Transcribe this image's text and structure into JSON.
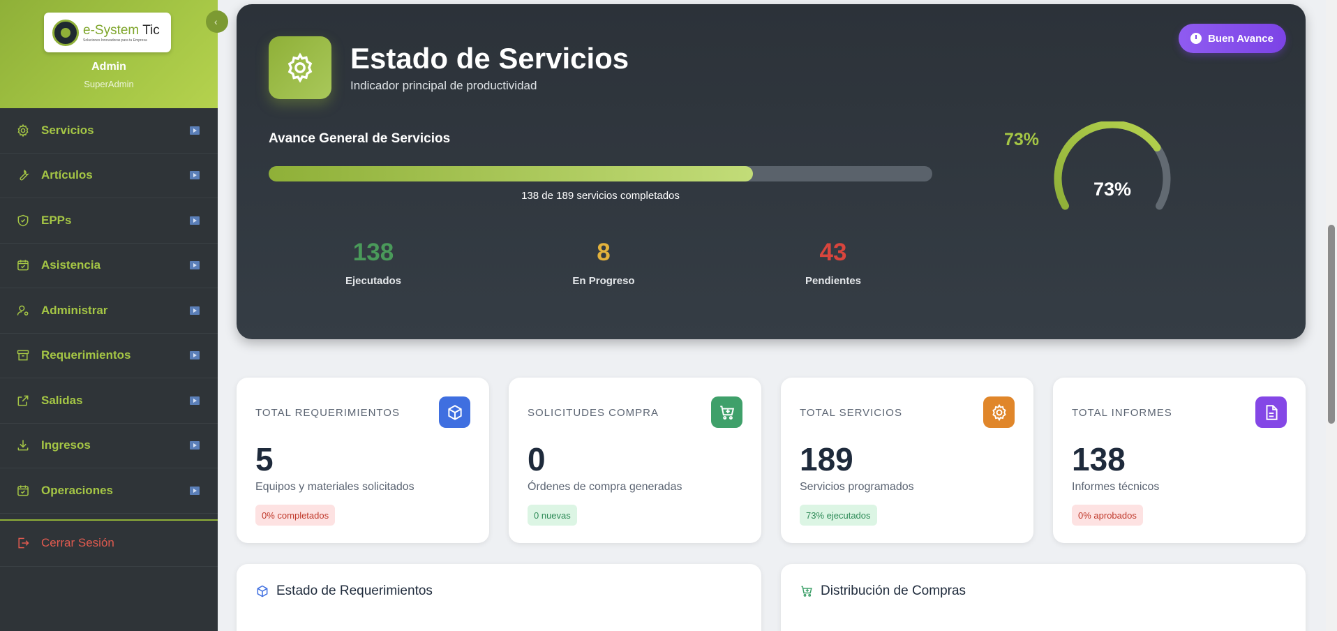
{
  "sidebar": {
    "logo": {
      "text_main": "e-System",
      "text_accent": "Tic",
      "tagline": "Soluciones Innovadoras para tu Empresa"
    },
    "user": {
      "name": "Admin",
      "role": "SuperAdmin"
    },
    "items": [
      {
        "label": "Servicios",
        "icon": "gear-icon"
      },
      {
        "label": "Artículos",
        "icon": "wrench-icon"
      },
      {
        "label": "EPPs",
        "icon": "shield-icon"
      },
      {
        "label": "Asistencia",
        "icon": "calendar-check-icon"
      },
      {
        "label": "Administrar",
        "icon": "user-gear-icon"
      },
      {
        "label": "Requerimientos",
        "icon": "archive-icon"
      },
      {
        "label": "Salidas",
        "icon": "external-link-icon"
      },
      {
        "label": "Ingresos",
        "icon": "download-icon"
      },
      {
        "label": "Operaciones",
        "icon": "calendar-check-icon"
      }
    ],
    "logout": {
      "label": "Cerrar Sesión",
      "icon": "logout-icon"
    }
  },
  "hero": {
    "title": "Estado de Servicios",
    "subtitle": "Indicador principal de productividad",
    "badge": "Buen Avance",
    "progress_label": "Avance General de Servicios",
    "progress_pct_text": "73%",
    "progress": 0.73,
    "caption": "138 de 189 servicios completados",
    "gauge_text": "73%",
    "stats": [
      {
        "value": "138",
        "label": "Ejecutados",
        "color": "#4a9a5a"
      },
      {
        "value": "8",
        "label": "En Progreso",
        "color": "#e3b23c"
      },
      {
        "value": "43",
        "label": "Pendientes",
        "color": "#d9453d"
      }
    ]
  },
  "cards": [
    {
      "title": "TOTAL REQUERIMIENTOS",
      "value": "5",
      "desc": "Equipos y materiales solicitados",
      "pill": "0% completados",
      "pill_style": "red",
      "icon": "box-icon",
      "icon_color": "#3f6fe0"
    },
    {
      "title": "SOLICITUDES COMPRA",
      "value": "0",
      "desc": "Órdenes de compra generadas",
      "pill": "0 nuevas",
      "pill_style": "green",
      "icon": "cart-plus-icon",
      "icon_color": "#3fa06a"
    },
    {
      "title": "TOTAL SERVICIOS",
      "value": "189",
      "desc": "Servicios programados",
      "pill": "73% ejecutados",
      "pill_style": "green",
      "icon": "gear-icon",
      "icon_color": "#e0862a"
    },
    {
      "title": "TOTAL INFORMES",
      "value": "138",
      "desc": "Informes técnicos",
      "pill": "0% aprobados",
      "pill_style": "red",
      "icon": "document-icon",
      "icon_color": "#8447e6"
    }
  ],
  "panels": [
    {
      "title": "Estado de Requerimientos",
      "icon": "box-icon",
      "icon_color": "#3f6fe0"
    },
    {
      "title": "Distribución de Compras",
      "icon": "cart-plus-icon",
      "icon_color": "#3fa06a"
    }
  ]
}
